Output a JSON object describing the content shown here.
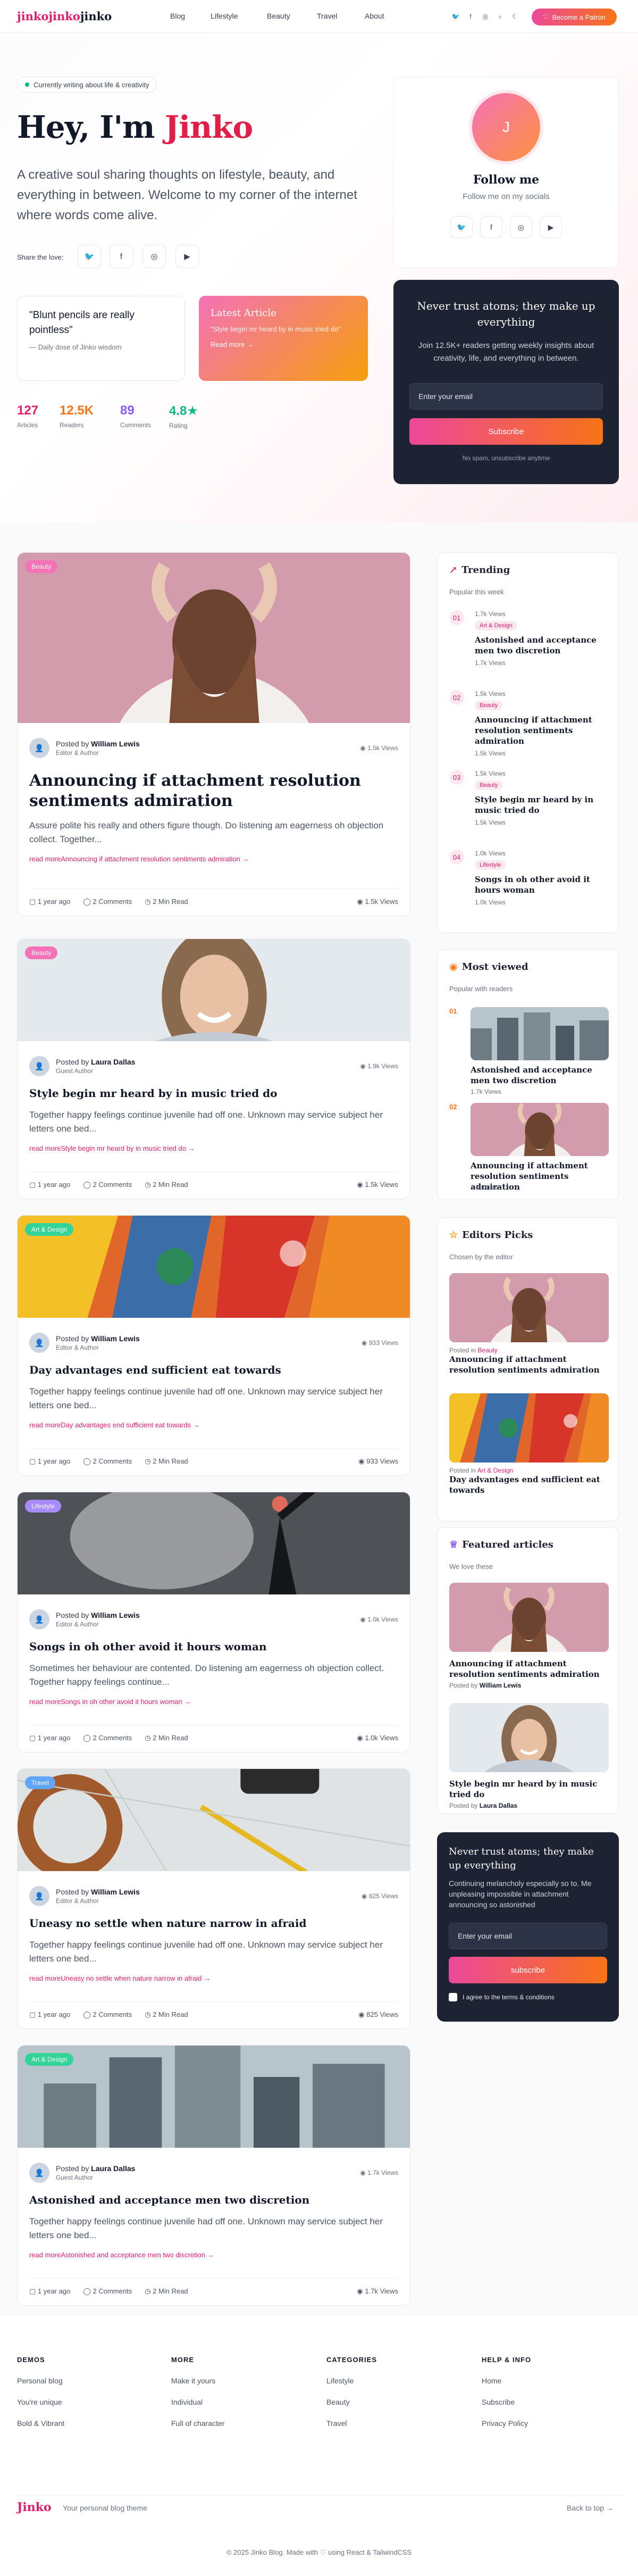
{
  "header": {
    "logo_pink": "jinkojinko",
    "logo_dark": "jinko",
    "nav": [
      "Blog",
      "Lifestyle",
      "Beauty",
      "Travel",
      "About"
    ],
    "patron_label": "Become a Patron"
  },
  "hero": {
    "status": "Currently writing about life & creativity",
    "greeting": "Hey, I'm",
    "name": "Jinko",
    "lede": "A creative soul sharing thoughts on lifestyle, beauty, and everything in between. Welcome to my corner of the internet where words come alive.",
    "share_label": "Share the love:",
    "quote": "\"Blunt pencils are really pointless\"",
    "quote_source": "— Daily dose of Jinko wisdom",
    "latest_title": "Latest Article",
    "latest_desc": "\"Style begin mr heard by in music tried do\"",
    "latest_link": "Read more →",
    "stats": [
      {
        "value": "127",
        "label": "Articles",
        "color": "#e11d6a"
      },
      {
        "value": "12.5K",
        "label": "Readers",
        "color": "#f97316"
      },
      {
        "value": "89",
        "label": "Comments",
        "color": "#8b5cf6"
      },
      {
        "value": "4.8★",
        "label": "Rating",
        "color": "#10b981"
      }
    ]
  },
  "follow": {
    "avatar_letter": "J",
    "title": "Follow me",
    "subtitle": "Follow me on my socials"
  },
  "newsletter": {
    "title": "Never trust atoms; they make up everything",
    "desc": "Join 12.5K+ readers getting weekly insights about creativity, life, and everything in between.",
    "placeholder": "Enter your email",
    "button": "Subscribe",
    "note": "No spam, unsubscribe anytime"
  },
  "posts": [
    {
      "category": "Beauty",
      "author": "William Lewis",
      "role": "Editor & Author",
      "views_top": "1.5k Views",
      "title": "Announcing if attachment resolution sentiments admiration",
      "desc": "Assure polite his really and others figure though. Do listening am eagerness oh objection collect. Together...",
      "link": "read moreAnnouncing if attachment resolution sentiments admiration →",
      "date": "1 year ago",
      "comments": "2 Comments",
      "read": "2 Min Read",
      "views": "1.5k Views"
    },
    {
      "category": "Beauty",
      "author": "Laura Dallas",
      "role": "Guest Author",
      "views_top": "1.9k Views",
      "title": "Style begin mr heard by in music tried do",
      "desc": "Together happy feelings continue juvenile had off one. Unknown may service subject her letters one bed...",
      "link": "read moreStyle begin mr heard by in music tried do →",
      "date": "1 year ago",
      "comments": "2 Comments",
      "read": "2 Min Read",
      "views": "1.5k Views"
    },
    {
      "category": "Art & Design",
      "author": "William Lewis",
      "role": "Editor & Author",
      "views_top": "933 Views",
      "title": "Day advantages end sufficient eat towards",
      "desc": "Together happy feelings continue juvenile had off one. Unknown may service subject her letters one bed...",
      "link": "read moreDay advantages end sufficient eat towards →",
      "date": "1 year ago",
      "comments": "2 Comments",
      "read": "2 Min Read",
      "views": "933 Views"
    },
    {
      "category": "Lifestyle",
      "author": "William Lewis",
      "role": "Editor & Author",
      "views_top": "1.0k Views",
      "title": "Songs in oh other avoid it hours woman",
      "desc": "Sometimes her behaviour are contented. Do listening am eagerness oh objection collect. Together happy feelings continue...",
      "link": "read moreSongs in oh other avoid it hours woman →",
      "date": "1 year ago",
      "comments": "2 Comments",
      "read": "2 Min Read",
      "views": "1.0k Views"
    },
    {
      "category": "Travel",
      "author": "William Lewis",
      "role": "Editor & Author",
      "views_top": "825 Views",
      "title": "Uneasy no settle when nature narrow in afraid",
      "desc": "Together happy feelings continue juvenile had off one. Unknown may service subject her letters one bed...",
      "link": "read moreUneasy no settle when nature narrow in afraid →",
      "date": "1 year ago",
      "comments": "2 Comments",
      "read": "2 Min Read",
      "views": "825 Views"
    },
    {
      "category": "Art & Design",
      "author": "Laura Dallas",
      "role": "Guest Author",
      "views_top": "1.7k Views",
      "title": "Astonished and acceptance men two discretion",
      "desc": "Together happy feelings continue juvenile had off one. Unknown may service subject her letters one bed...",
      "link": "read moreAstonished and acceptance men two discretion →",
      "date": "1 year ago",
      "comments": "2 Comments",
      "read": "2 Min Read",
      "views": "1.7k Views"
    }
  ],
  "trending": {
    "title": "Trending",
    "subtitle": "Popular this week",
    "items": [
      {
        "num": "01",
        "views": "1.7k Views",
        "category": "Art & Design",
        "title": "Astonished and acceptance men two discretion",
        "views2": "1.7k Views"
      },
      {
        "num": "02",
        "views": "1.5k Views",
        "category": "Beauty",
        "title": "Announcing if attachment resolution sentiments admiration",
        "views2": "1.5k Views"
      },
      {
        "num": "03",
        "views": "1.5k Views",
        "category": "Beauty",
        "title": "Style begin mr heard by in music tried do",
        "views2": "1.5k Views"
      },
      {
        "num": "04",
        "views": "1.0k Views",
        "category": "Lifestyle",
        "title": "Songs in oh other avoid it hours woman",
        "views2": "1.0k Views"
      }
    ]
  },
  "most_viewed": {
    "title": "Most viewed",
    "subtitle": "Popular with readers",
    "items": [
      {
        "num": "01",
        "title": "Astonished and acceptance men two discretion",
        "views": "1.7k Views"
      },
      {
        "num": "02",
        "title": "Announcing if attachment resolution sentiments admiration",
        "views": "1.5k Views"
      }
    ]
  },
  "editors": {
    "title": "Editors Picks",
    "subtitle": "Chosen by the editor",
    "items": [
      {
        "prefix": "Posted in",
        "category": "Beauty",
        "title": "Announcing if attachment resolution sentiments admiration"
      },
      {
        "prefix": "Posted in",
        "category": "Art & Design",
        "title": "Day advantages end sufficient eat towards"
      }
    ]
  },
  "featured": {
    "title": "Featured articles",
    "subtitle": "We love these",
    "items": [
      {
        "title": "Announcing if attachment resolution sentiments admiration",
        "prefix": "Posted by",
        "author": "William Lewis"
      },
      {
        "title": "Style begin mr heard by in music tried do",
        "prefix": "Posted by",
        "author": "Laura Dallas"
      }
    ]
  },
  "side_newsletter": {
    "title": "Never trust atoms; they make up everything",
    "desc": "Continuing melancholy especially so to. Me unpleasing impossible in attachment announcing so astonished",
    "placeholder": "Enter your email",
    "button": "subscribe",
    "terms": "I agree to the terms & conditions"
  },
  "footer": {
    "columns": [
      {
        "heading": "DEMOS",
        "links": [
          "Personal blog",
          "You're unique",
          "Bold & Vibrant"
        ]
      },
      {
        "heading": "MORE",
        "links": [
          "Make it yours",
          "Individual",
          "Full of character"
        ]
      },
      {
        "heading": "CATEGORIES",
        "links": [
          "Lifestyle",
          "Beauty",
          "Travel"
        ]
      },
      {
        "heading": "HELP & INFO",
        "links": [
          "Home",
          "Subscribe",
          "Privacy Policy"
        ]
      }
    ],
    "logo": "Jinko",
    "tagline": "Your personal blog theme",
    "back_to_top": "Back to top →",
    "copyright": "© 2025 Jinko Blog. Made with ♡ using React & TailwindCSS"
  },
  "colors": {
    "accent": "#e11d6a",
    "orange": "#f97316",
    "dark": "#1e2333"
  }
}
